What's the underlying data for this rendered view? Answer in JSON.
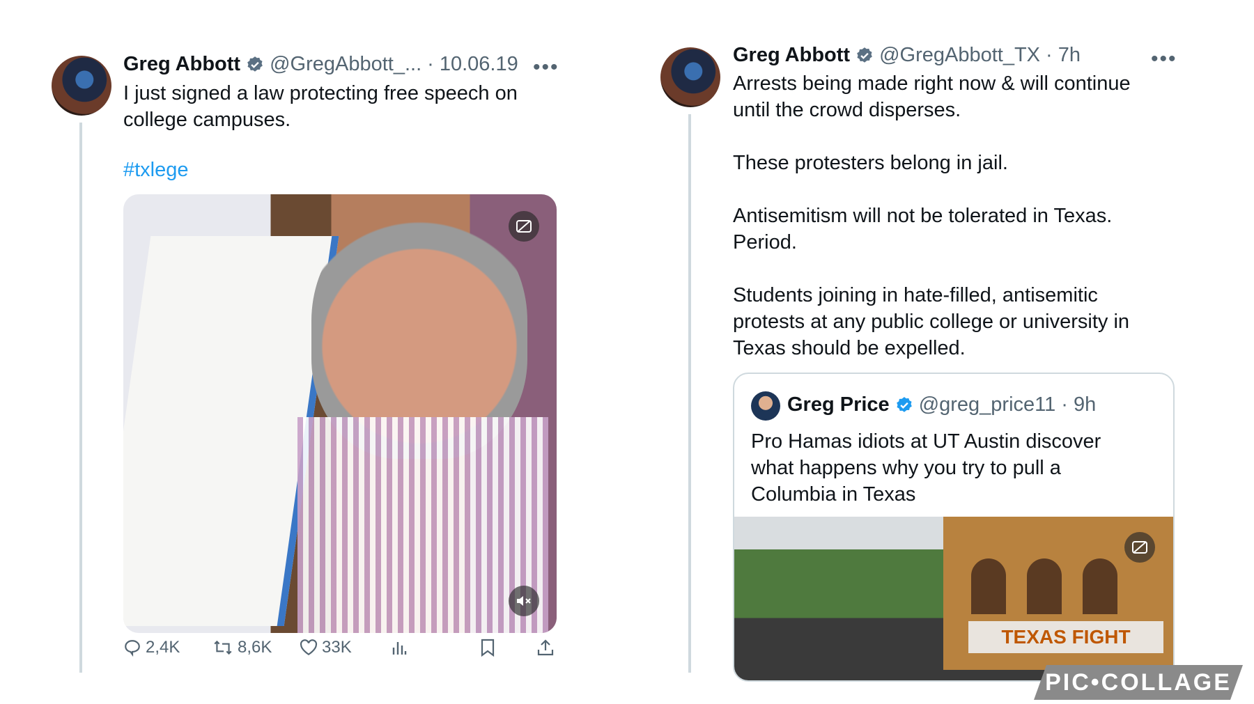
{
  "left_tweet": {
    "name": "Greg Abbott",
    "handle": "@GregAbbott_...",
    "separator": "·",
    "date": "10.06.19",
    "more": "•••",
    "text": "I just signed a law protecting free speech on\ncollege campuses.",
    "hashtag": "#txlege",
    "replies": "2,4K",
    "retweets": "8,6K",
    "likes": "33K"
  },
  "right_tweet": {
    "name": "Greg Abbott",
    "handle": "@GregAbbott_TX",
    "separator": "·",
    "time": "7h",
    "more": "•••",
    "text": "Arrests being made right now & will continue\nuntil the crowd disperses.\n\nThese protesters belong in jail.\n\nAntisemitism will not be tolerated in Texas.\nPeriod.\n\nStudents joining in hate-filled, antisemitic\nprotests at any public college or university in\nTexas should be expelled.",
    "quote": {
      "name": "Greg Price",
      "handle": "@greg_price11",
      "separator": "·",
      "time": "9h",
      "text": "Pro Hamas idiots at UT Austin discover\nwhat happens why you try to pull a\nColumbia in Texas",
      "banner": "TEXAS FIGHT"
    }
  },
  "watermark": "PIC•COLLAGE",
  "colors": {
    "accent": "#1d9bf0",
    "muted": "#536471",
    "border": "#cfd9de",
    "ut_orange": "#bf5700"
  },
  "icons": [
    "verified-badge-icon",
    "more-icon",
    "captions-icon",
    "mute-icon",
    "reply-icon",
    "retweet-icon",
    "like-icon",
    "views-icon",
    "bookmark-icon",
    "share-icon"
  ]
}
